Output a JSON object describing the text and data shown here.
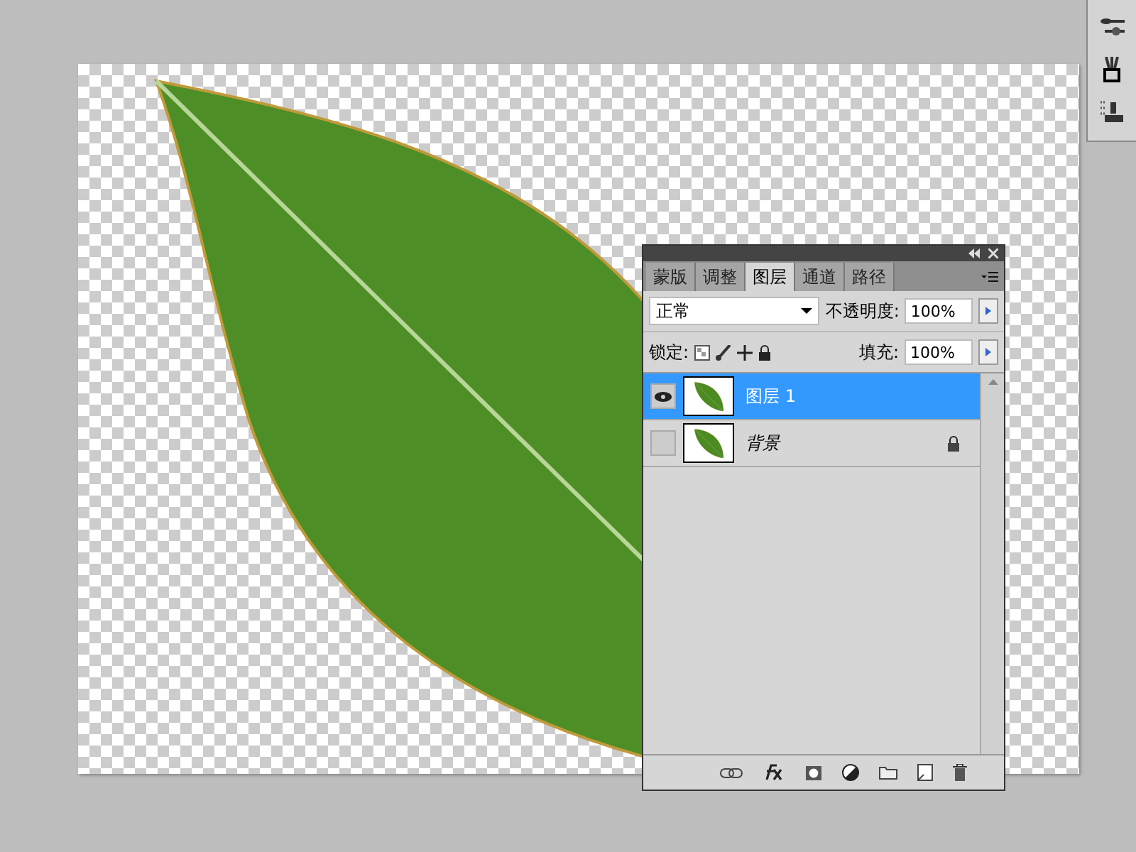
{
  "panel": {
    "tabs": [
      {
        "label": "蒙版",
        "selected": false
      },
      {
        "label": "调整",
        "selected": false
      },
      {
        "label": "图层",
        "selected": true
      },
      {
        "label": "通道",
        "selected": false
      },
      {
        "label": "路径",
        "selected": false
      }
    ],
    "blend_mode": "正常",
    "opacity_label": "不透明度:",
    "opacity": "100%",
    "lock_label": "锁定:",
    "fill_label": "填充:",
    "fill": "100%",
    "layers": [
      {
        "name": "图层 1",
        "kind": "layer",
        "selected": true,
        "visible": true,
        "locked": false
      },
      {
        "name": "背景",
        "kind": "background",
        "selected": false,
        "visible": false,
        "locked": true
      }
    ]
  }
}
